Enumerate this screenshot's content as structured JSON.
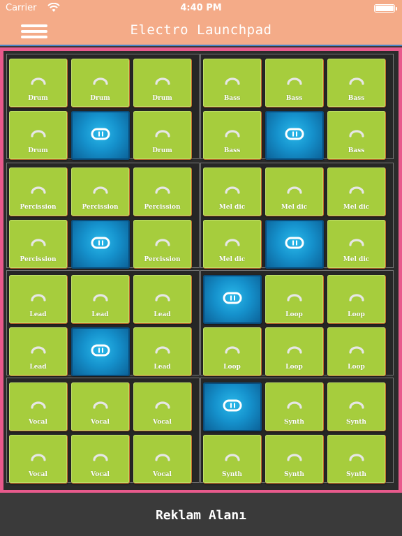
{
  "status_bar": {
    "carrier": "Carrier",
    "time": "4:40 PM"
  },
  "nav": {
    "title": "Electro Launchpad",
    "menu_icon": "hamburger-menu-icon"
  },
  "colors": {
    "header": "#f4ab88",
    "frame": "#e85a8c",
    "pad_green": "#a6cd3d",
    "pad_blue": "#1591cc",
    "board": "#2b2b2b"
  },
  "sections": [
    {
      "name": "drum",
      "pads": [
        {
          "label": "Drum",
          "active": false
        },
        {
          "label": "Drum",
          "active": false
        },
        {
          "label": "Drum",
          "active": false
        },
        {
          "label": "Drum",
          "active": false
        },
        {
          "label": "",
          "active": true
        },
        {
          "label": "Drum",
          "active": false
        }
      ]
    },
    {
      "name": "bass",
      "pads": [
        {
          "label": "Bass",
          "active": false
        },
        {
          "label": "Bass",
          "active": false
        },
        {
          "label": "Bass",
          "active": false
        },
        {
          "label": "Bass",
          "active": false
        },
        {
          "label": "",
          "active": true
        },
        {
          "label": "Bass",
          "active": false
        }
      ]
    },
    {
      "name": "percission",
      "pads": [
        {
          "label": "Percission",
          "active": false
        },
        {
          "label": "Percission",
          "active": false
        },
        {
          "label": "Percission",
          "active": false
        },
        {
          "label": "Percission",
          "active": false
        },
        {
          "label": "",
          "active": true
        },
        {
          "label": "Percission",
          "active": false
        }
      ]
    },
    {
      "name": "melodic",
      "pads": [
        {
          "label": "Mel dic",
          "active": false
        },
        {
          "label": "Mel dic",
          "active": false
        },
        {
          "label": "Mel dic",
          "active": false
        },
        {
          "label": "Mel dic",
          "active": false
        },
        {
          "label": "",
          "active": true
        },
        {
          "label": "Mel dic",
          "active": false
        }
      ]
    },
    {
      "name": "lead",
      "pads": [
        {
          "label": "Lead",
          "active": false
        },
        {
          "label": "Lead",
          "active": false
        },
        {
          "label": "Lead",
          "active": false
        },
        {
          "label": "Lead",
          "active": false
        },
        {
          "label": "",
          "active": true
        },
        {
          "label": "Lead",
          "active": false
        }
      ]
    },
    {
      "name": "loop",
      "pads": [
        {
          "label": "",
          "active": true
        },
        {
          "label": "Loop",
          "active": false
        },
        {
          "label": "Loop",
          "active": false
        },
        {
          "label": "Loop",
          "active": false
        },
        {
          "label": "Loop",
          "active": false
        },
        {
          "label": "Loop",
          "active": false
        }
      ]
    },
    {
      "name": "vocal",
      "pads": [
        {
          "label": "Vocal",
          "active": false
        },
        {
          "label": "Vocal",
          "active": false
        },
        {
          "label": "Vocal",
          "active": false
        },
        {
          "label": "Vocal",
          "active": false
        },
        {
          "label": "Vocal",
          "active": false
        },
        {
          "label": "Vocal",
          "active": false
        }
      ]
    },
    {
      "name": "synth",
      "pads": [
        {
          "label": "",
          "active": true
        },
        {
          "label": "Synth",
          "active": false
        },
        {
          "label": "Synth",
          "active": false
        },
        {
          "label": "Synth",
          "active": false
        },
        {
          "label": "Synth",
          "active": false
        },
        {
          "label": "Synth",
          "active": false
        }
      ]
    }
  ],
  "ad": {
    "text": "Reklam Alanı"
  }
}
